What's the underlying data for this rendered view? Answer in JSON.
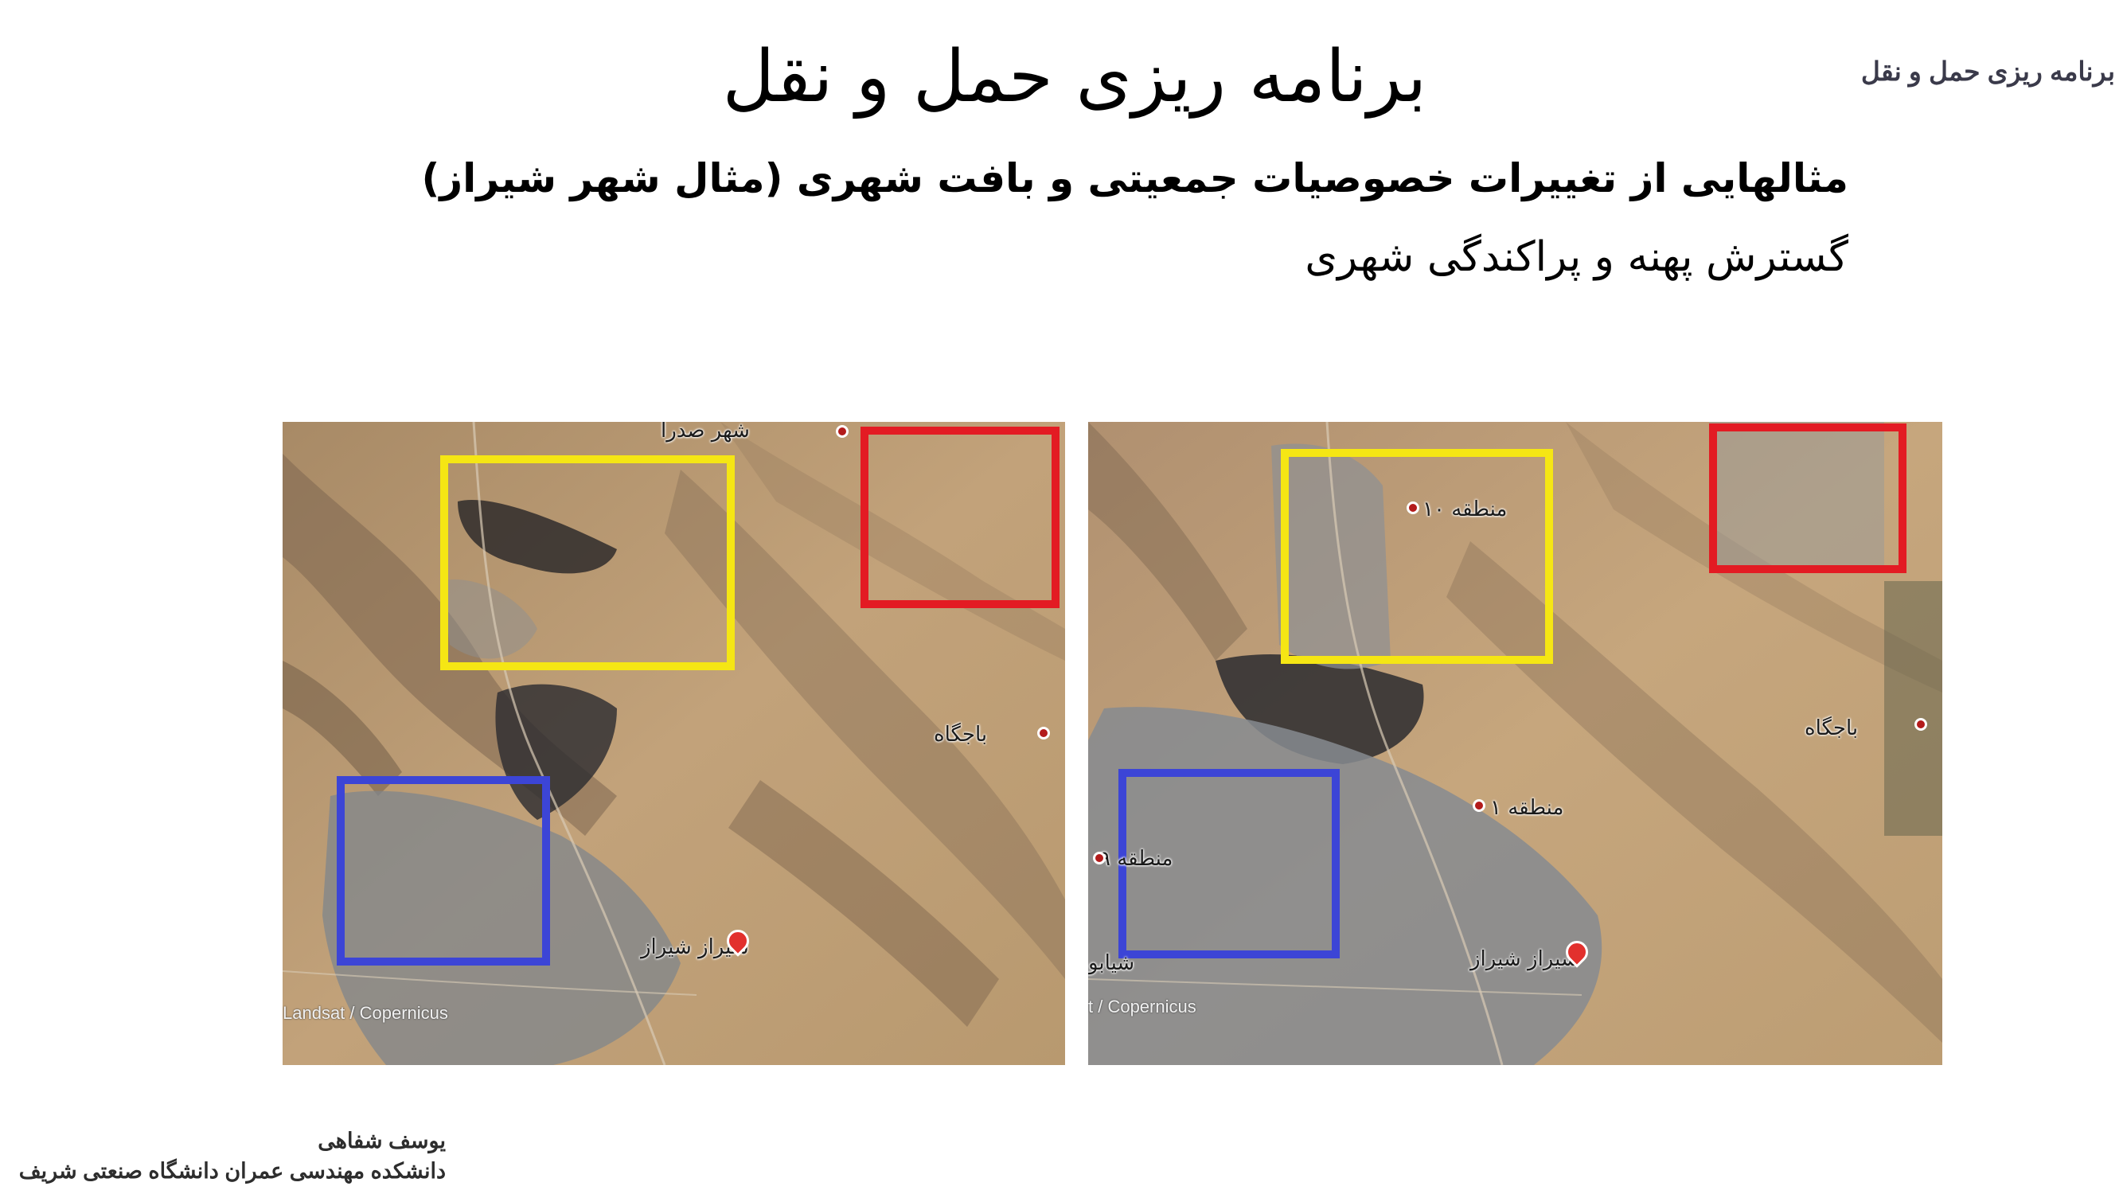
{
  "header": {
    "course": "برنامه ریزی حمل و نقل"
  },
  "slide": {
    "title": "برنامه ریزی حمل و نقل",
    "subtitle": "مثالهایی از تغییرات خصوصیات جمعیتی و بافت شهری (مثال شهر شیراز)",
    "subhead": "گسترش پهنه و پراکندگی شهری"
  },
  "maps": {
    "left": {
      "labels": {
        "sadra": "شهر صدرا",
        "bajgah": "باجگاه",
        "shiraz": "شیراز شیراز"
      },
      "copyright": "Landsat / Copernicus"
    },
    "right": {
      "labels": {
        "mantaghe10": "منطقه ۱۰",
        "bajgah": "باجگاه",
        "mantaghe1": "منطقه ۱",
        "mantaghe9": "منطقه ۹",
        "shiraz": "شیراز شیراز",
        "shirabo": "شیابو"
      },
      "copyright": "t / Copernicus"
    }
  },
  "highlight_colors": {
    "yellow": "#f5e614",
    "red": "#e31b23",
    "blue": "#3c45d6"
  },
  "footer": {
    "author": "یوسف شفاهی",
    "affiliation": "دانشکده مهندسی عمران  دانشگاه صنعتی شریف"
  }
}
